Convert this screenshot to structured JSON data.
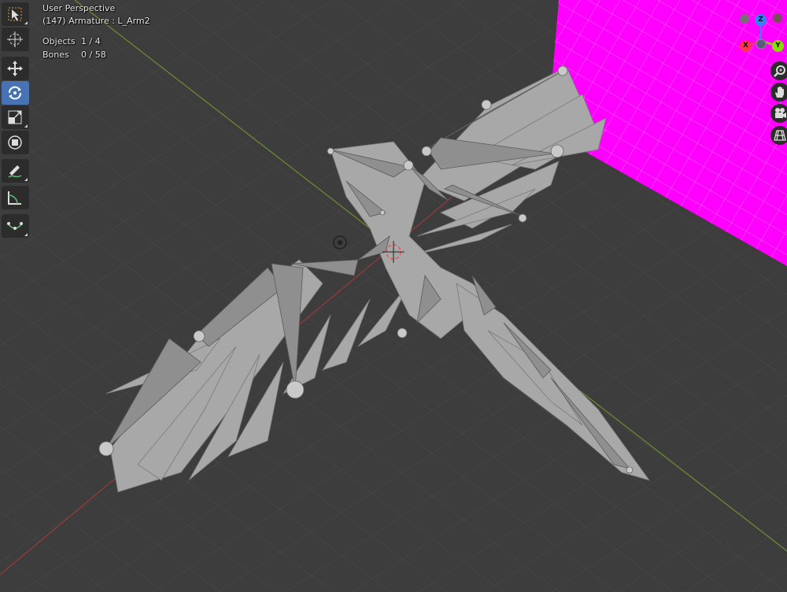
{
  "viewport": {
    "view_name": "User Perspective",
    "active_object": "(147) Armature : L_Arm2",
    "stats": [
      {
        "label": "Objects",
        "value": "1 / 4"
      },
      {
        "label": "Bones",
        "value": "0 / 58"
      }
    ]
  },
  "toolbar": {
    "tools": [
      {
        "name": "select-box-tool",
        "icon": "select-box-icon",
        "active": false
      },
      {
        "name": "cursor-tool",
        "icon": "cursor-icon",
        "active": false
      },
      {
        "name": "move-tool",
        "icon": "move-icon",
        "active": false
      },
      {
        "name": "rotate-tool",
        "icon": "rotate-icon",
        "active": true
      },
      {
        "name": "scale-tool",
        "icon": "scale-icon",
        "active": false
      },
      {
        "name": "transform-tool",
        "icon": "transform-icon",
        "active": false
      },
      {
        "name": "annotate-tool",
        "icon": "annotate-icon",
        "active": false
      },
      {
        "name": "measure-tool",
        "icon": "measure-icon",
        "active": false
      },
      {
        "name": "bone-envelope-tool",
        "icon": "bone-envelope-icon",
        "active": false
      }
    ]
  },
  "gizmo": {
    "axes": [
      {
        "label": "Z",
        "color": "#2f83ff"
      },
      {
        "label": "X",
        "color": "#ff3352"
      },
      {
        "label": "Y",
        "color": "#8bdc00"
      }
    ]
  },
  "nav_buttons": [
    {
      "name": "zoom-button",
      "icon": "zoom-icon"
    },
    {
      "name": "pan-button",
      "icon": "hand-icon"
    },
    {
      "name": "camera-view-button",
      "icon": "camera-icon"
    },
    {
      "name": "perspective-toggle-button",
      "icon": "grid-icon"
    }
  ],
  "colors": {
    "background": "#3d3d3d",
    "grid": "#4a4a4a",
    "x_axis": "#9a3a3a",
    "y_axis": "#6e8f2e",
    "plane": "#ff00ff",
    "mesh": "#a8a8a8",
    "active_tool": "#4772b3"
  }
}
